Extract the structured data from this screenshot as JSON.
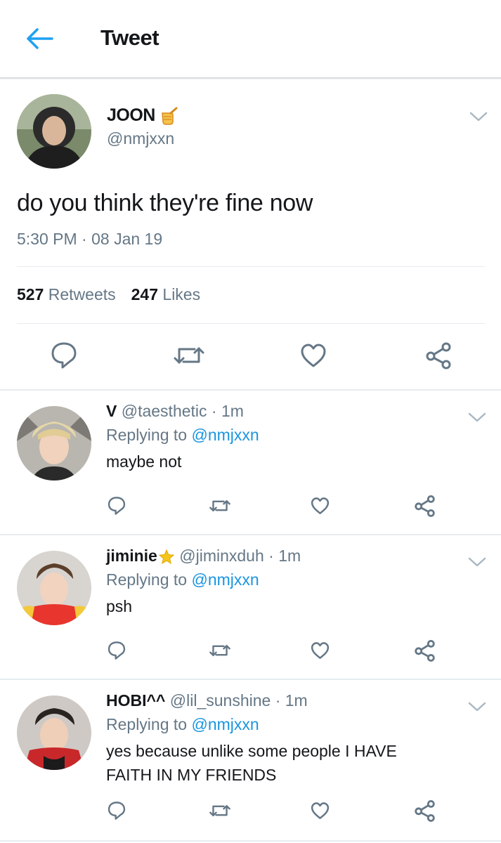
{
  "header": {
    "title": "Tweet"
  },
  "tweet": {
    "name": "JOON",
    "handle": "@nmjxxn",
    "text": "do you think they're fine now",
    "time": "5:30 PM · 08 Jan 19",
    "retweets_count": "527",
    "retweets_label": "Retweets",
    "likes_count": "247",
    "likes_label": "Likes"
  },
  "replies": [
    {
      "name": "V",
      "handle": "@taesthetic · 1m",
      "replying_prefix": "Replying to",
      "replying_to": "@nmjxxn",
      "text": "maybe not"
    },
    {
      "name": "jiminie",
      "handle": "@jiminxduh · 1m",
      "replying_prefix": "Replying to",
      "replying_to": "@nmjxxn",
      "text": "psh"
    },
    {
      "name": "HOBI^^",
      "handle": "@lil_sunshine · 1m",
      "replying_prefix": "Replying to",
      "replying_to": "@nmjxxn",
      "text": "yes because unlike some people I HAVE FAITH IN MY FRIENDS"
    }
  ],
  "colors": {
    "accent": "#1b95e0",
    "muted": "#657786",
    "text": "#14171a",
    "divider": "#e6ecf0"
  },
  "icons": [
    "back-arrow-icon",
    "chevron-down-icon",
    "reply-icon",
    "retweet-icon",
    "like-icon",
    "share-icon"
  ]
}
